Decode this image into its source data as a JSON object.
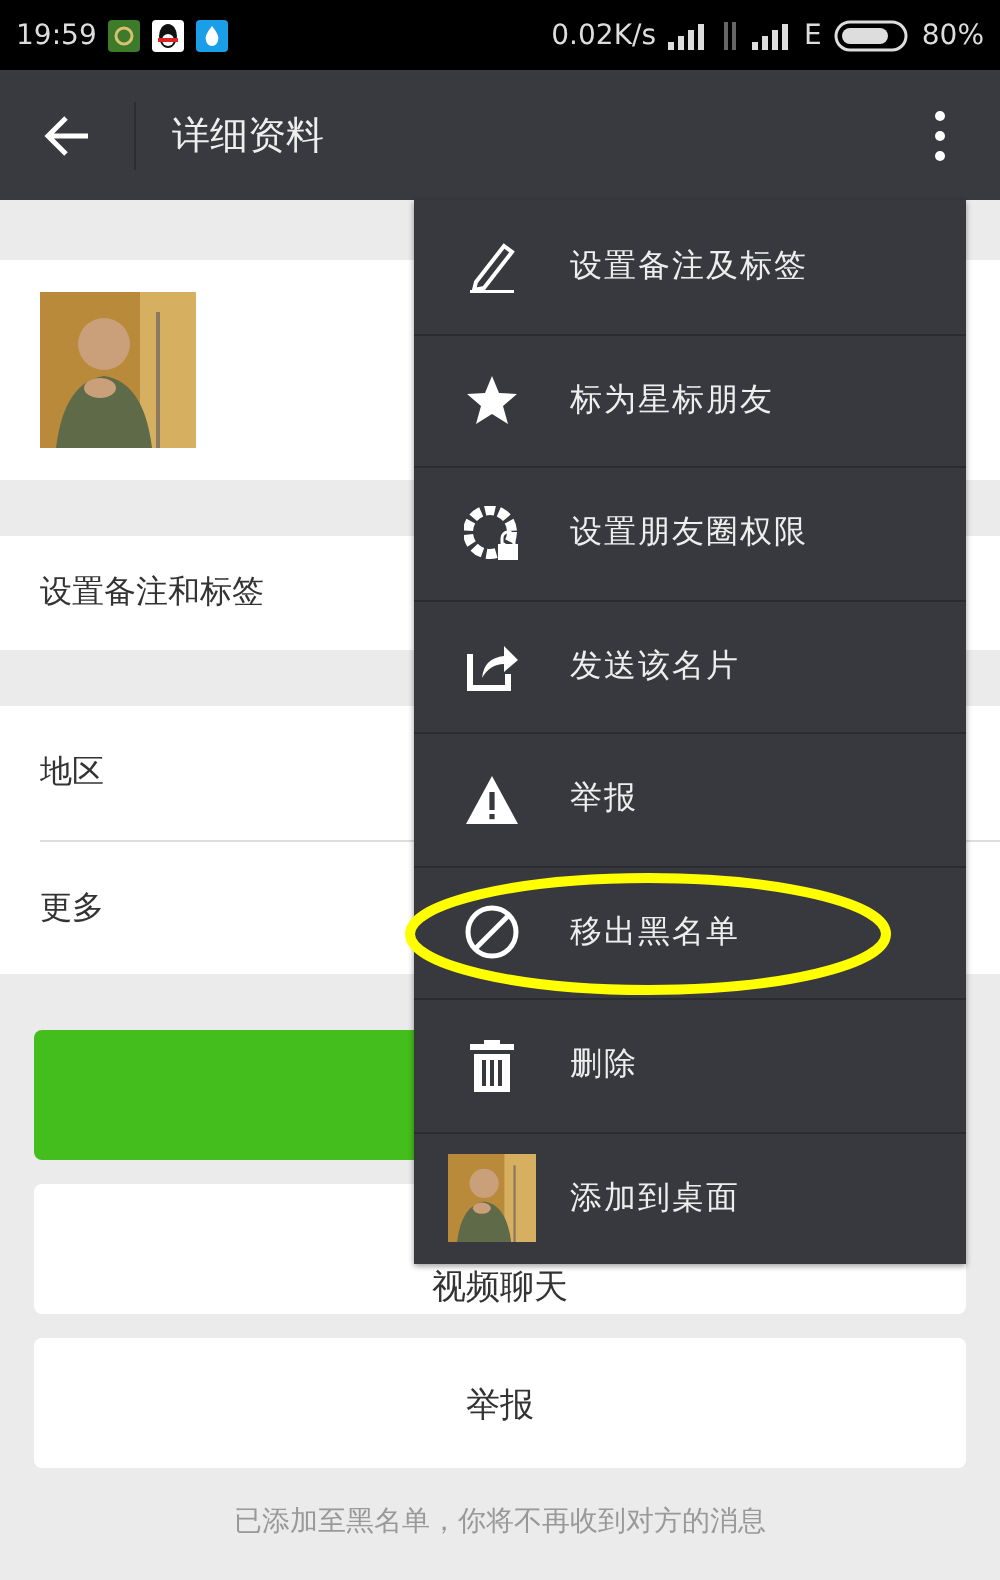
{
  "status_bar": {
    "time": "19:59",
    "speed": "0.02K/s",
    "network": "E",
    "battery": "80%"
  },
  "app_bar": {
    "title": "详细资料"
  },
  "remark_row": {
    "label": "设置备注和标签"
  },
  "info_rows": [
    {
      "label": "地区"
    },
    {
      "label": "更多"
    }
  ],
  "buttons": [
    {
      "kind": "primary"
    },
    {
      "kind": "plain",
      "label": "视频聊天"
    },
    {
      "kind": "plain",
      "label": "举报"
    }
  ],
  "footer_note": "已添加至黑名单，你将不再收到对方的消息",
  "menu": {
    "items": [
      {
        "kind": "icon",
        "label": "设置备注及标签",
        "annotated": false
      },
      {
        "kind": "icon",
        "label": "标为星标朋友",
        "annotated": false
      },
      {
        "kind": "icon",
        "label": "设置朋友圈权限",
        "annotated": false
      },
      {
        "kind": "icon",
        "label": "发送该名片",
        "annotated": false
      },
      {
        "kind": "icon",
        "label": "举报",
        "annotated": false
      },
      {
        "kind": "icon",
        "label": "移出黑名单",
        "annotated": true
      },
      {
        "kind": "icon",
        "label": "删除",
        "annotated": false
      },
      {
        "kind": "picture",
        "label": "添加到桌面",
        "annotated": false
      }
    ]
  }
}
